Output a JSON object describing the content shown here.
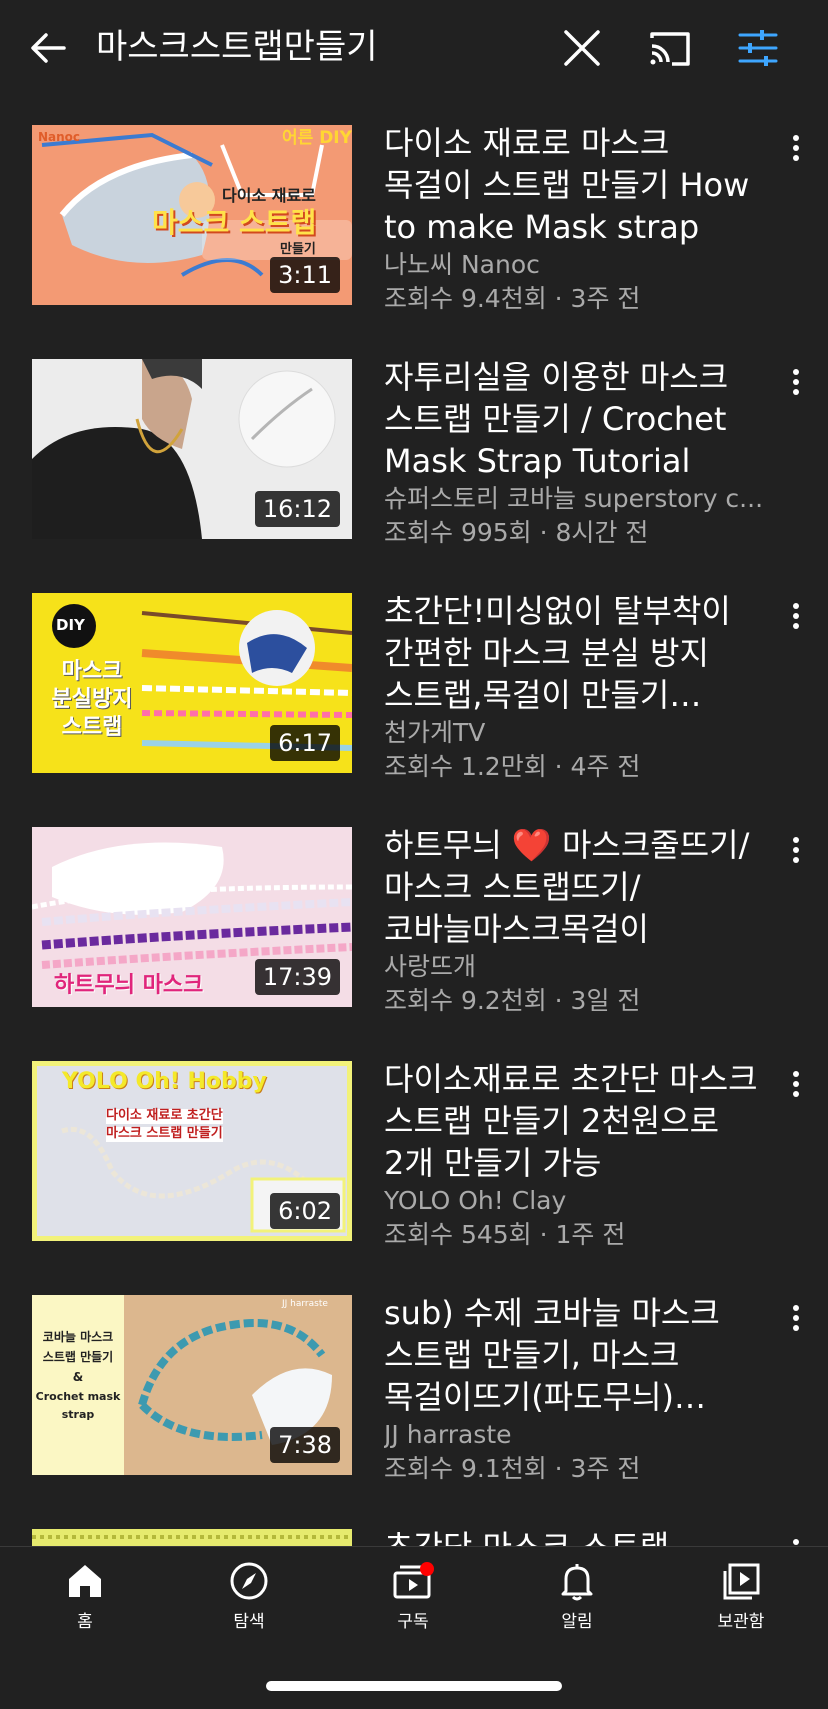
{
  "search": {
    "query": "마스크스트랩만들기"
  },
  "videos": [
    {
      "title": "다이소 재료로 마스크 목걸이 스트랩 만들기 How to make Mask strap",
      "channel": "나노씨 Nanoc",
      "meta": "조회수 9.4천회 · 3주 전",
      "duration": "3:11",
      "thumb_text": [
        "Nanoc",
        "어른 DIY",
        "다이소 재료로",
        "마스크 스트랩",
        "만들기"
      ]
    },
    {
      "title": "자투리실을 이용한 마스크 스트랩 만들기 / Crochet Mask Strap Tutorial",
      "channel": "슈퍼스토리 코바늘 superstory c...",
      "meta": "조회수 995회 · 8시간 전",
      "duration": "16:12",
      "thumb_text": []
    },
    {
      "title": "초간단!미싱없이 탈부착이 간편한 마스크 분실 방지 스트랩,목걸이 만들기 DIY…",
      "channel": "천가게TV",
      "meta": "조회수 1.2만회 · 4주 전",
      "duration": "6:17",
      "thumb_text": [
        "DIY",
        "마스크",
        "분실방지",
        "스트랩"
      ]
    },
    {
      "title": "하트무늬 ❤️ 마스크줄뜨기/마스크 스트랩뜨기/코바늘마스크목걸이",
      "channel": "사랑뜨개",
      "meta": "조회수 9.2천회 · 3일 전",
      "duration": "17:39",
      "thumb_text": [
        "하트무늬 마스크"
      ]
    },
    {
      "title": "다이소재료로 초간단 마스크 스트랩 만들기  2천원으로 2개 만들기 가능",
      "channel": "YOLO Oh! Clay",
      "meta": "조회수 545회 · 1주 전",
      "duration": "6:02",
      "thumb_text": [
        "YOLO Oh! Hobby",
        "다이소 재료로 초간단",
        "마스크 스트랩 만들기"
      ]
    },
    {
      "title": "sub) 수제 코바늘  마스크 스트랩 만들기, 마스크 목걸이뜨기(파도무늬) 「설명…",
      "channel": "JJ harraste",
      "meta": "조회수 9.1천회 · 3주 전",
      "duration": "7:38",
      "thumb_text": [
        "코바늘 마스크",
        "스트랩 만들기",
        "&",
        "Crochet mask",
        "strap",
        "JJ harraste"
      ]
    },
    {
      "title": "초간단 마스크 스트랩 만들기",
      "channel": "",
      "meta": "",
      "duration": "",
      "thumb_text": []
    }
  ],
  "nav": [
    {
      "label": "홈",
      "icon": "home-icon"
    },
    {
      "label": "탐색",
      "icon": "explore-icon"
    },
    {
      "label": "구독",
      "icon": "subscriptions-icon"
    },
    {
      "label": "알림",
      "icon": "notifications-icon"
    },
    {
      "label": "보관함",
      "icon": "library-icon"
    }
  ],
  "colors": {
    "background": "#212121",
    "accent_blue": "#3ea6ff",
    "badge_red": "#ff0000",
    "secondary_text": "#aaaaaa"
  }
}
